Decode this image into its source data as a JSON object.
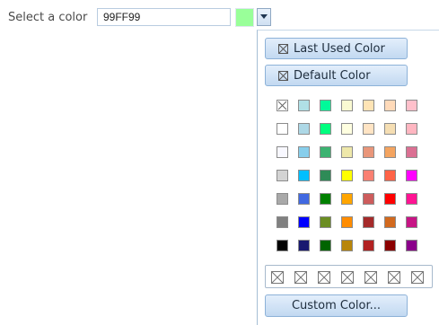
{
  "form": {
    "label": "Select a color",
    "value": "99FF99",
    "preview_color": "#99FF99"
  },
  "popup": {
    "last_used_label": "Last Used Color",
    "default_label": "Default Color",
    "custom_label": "Custom Color...",
    "palette": [
      [
        "none",
        "#B0E0E6",
        "#00FA9A",
        "#FAFAD2",
        "#FFE4B5",
        "#FFDAB9",
        "#FFC0CB"
      ],
      [
        "#FFFFFF",
        "#ADD8E6",
        "#00FF7F",
        "#FFFFE0",
        "#FFE4C4",
        "#F5DEB3",
        "#FFB6C1"
      ],
      [
        "#F8F8FF",
        "#87CEEB",
        "#3CB371",
        "#EEE8AA",
        "#E9967A",
        "#F4A460",
        "#DB7093"
      ],
      [
        "#D3D3D3",
        "#00BFFF",
        "#2E8B57",
        "#FFFF00",
        "#FA8072",
        "#FF6347",
        "#FF00FF"
      ],
      [
        "#A9A9A9",
        "#4169E1",
        "#008000",
        "#FFA500",
        "#CD5C5C",
        "#FF0000",
        "#FF1493"
      ],
      [
        "#808080",
        "#0000FF",
        "#6B8E23",
        "#FF8C00",
        "#A52A2A",
        "#D2691E",
        "#C71585"
      ],
      [
        "#000000",
        "#191970",
        "#006400",
        "#B8860B",
        "#B22222",
        "#8B0000",
        "#8B008B"
      ]
    ],
    "recent_colors": [
      "none",
      "none",
      "none",
      "none",
      "none",
      "none",
      "none"
    ]
  }
}
